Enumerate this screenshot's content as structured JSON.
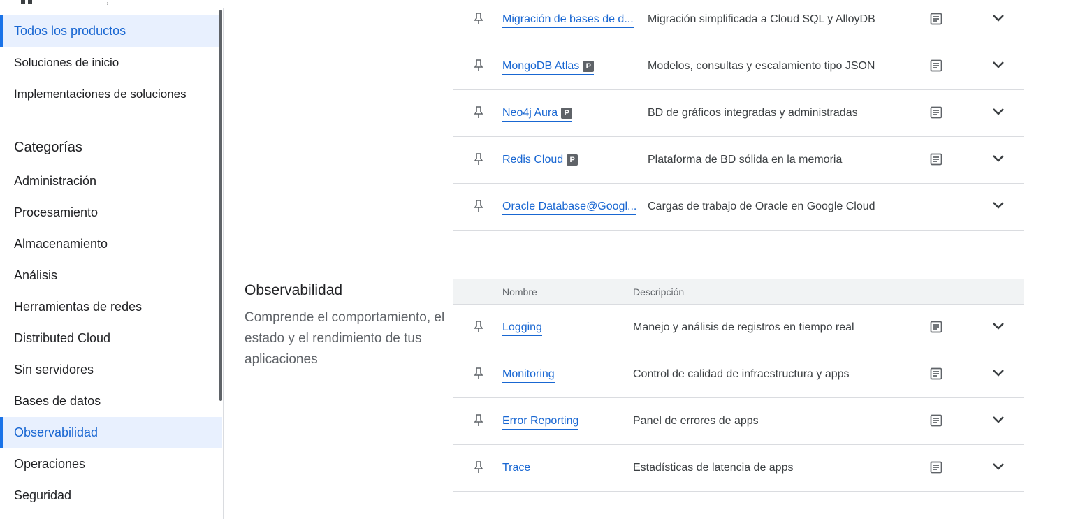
{
  "sidebar": {
    "top_items": [
      {
        "label": "Todos los productos",
        "active": true
      },
      {
        "label": "Soluciones de inicio",
        "active": false
      },
      {
        "label": "Implementaciones de soluciones",
        "active": false
      }
    ],
    "categories_heading": "Categorías",
    "categories": [
      {
        "label": "Administración",
        "active": false
      },
      {
        "label": "Procesamiento",
        "active": false
      },
      {
        "label": "Almacenamiento",
        "active": false
      },
      {
        "label": "Análisis",
        "active": false
      },
      {
        "label": "Herramientas de redes",
        "active": false
      },
      {
        "label": "Distributed Cloud",
        "active": false
      },
      {
        "label": "Sin servidores",
        "active": false
      },
      {
        "label": "Bases de datos",
        "active": false
      },
      {
        "label": "Observabilidad",
        "active": true
      },
      {
        "label": "Operaciones",
        "active": false
      },
      {
        "label": "Seguridad",
        "active": false
      }
    ]
  },
  "databases_rows": [
    {
      "name": "Migración de bases de d...",
      "partner": false,
      "description": "Migración simplificada a Cloud SQL y AlloyDB",
      "has_docs": true
    },
    {
      "name": "MongoDB Atlas",
      "partner": true,
      "description": "Modelos, consultas y escalamiento tipo JSON",
      "has_docs": true
    },
    {
      "name": "Neo4j Aura",
      "partner": true,
      "description": "BD de gráficos integradas y administradas",
      "has_docs": true
    },
    {
      "name": "Redis Cloud",
      "partner": true,
      "description": "Plataforma de BD sólida en la memoria",
      "has_docs": true
    },
    {
      "name": "Oracle Database@Googl...",
      "partner": false,
      "description": "Cargas de trabajo de Oracle en Google Cloud",
      "has_docs": false
    }
  ],
  "partner_badge": "P",
  "observability": {
    "title": "Observabilidad",
    "description": "Comprende el comportamiento, el estado y el rendimiento de tus aplicaciones",
    "header": {
      "name": "Nombre",
      "description": "Descripción"
    },
    "rows": [
      {
        "name": "Logging",
        "description": "Manejo y análisis de registros en tiempo real",
        "has_docs": true
      },
      {
        "name": "Monitoring",
        "description": "Control de calidad de infraestructura y apps",
        "has_docs": true
      },
      {
        "name": "Error Reporting",
        "description": "Panel de errores de apps",
        "has_docs": true
      },
      {
        "name": "Trace",
        "description": "Estadísticas de latencia de apps",
        "has_docs": true
      }
    ]
  },
  "icons": {
    "pin": "pin-icon",
    "docs": "docs-icon",
    "expand": "chevron-down-icon"
  },
  "colors": {
    "link": "#1967d2",
    "active_bg": "#e8f0fe",
    "accent": "#1a73e8",
    "badge_bg": "#5f6368"
  }
}
